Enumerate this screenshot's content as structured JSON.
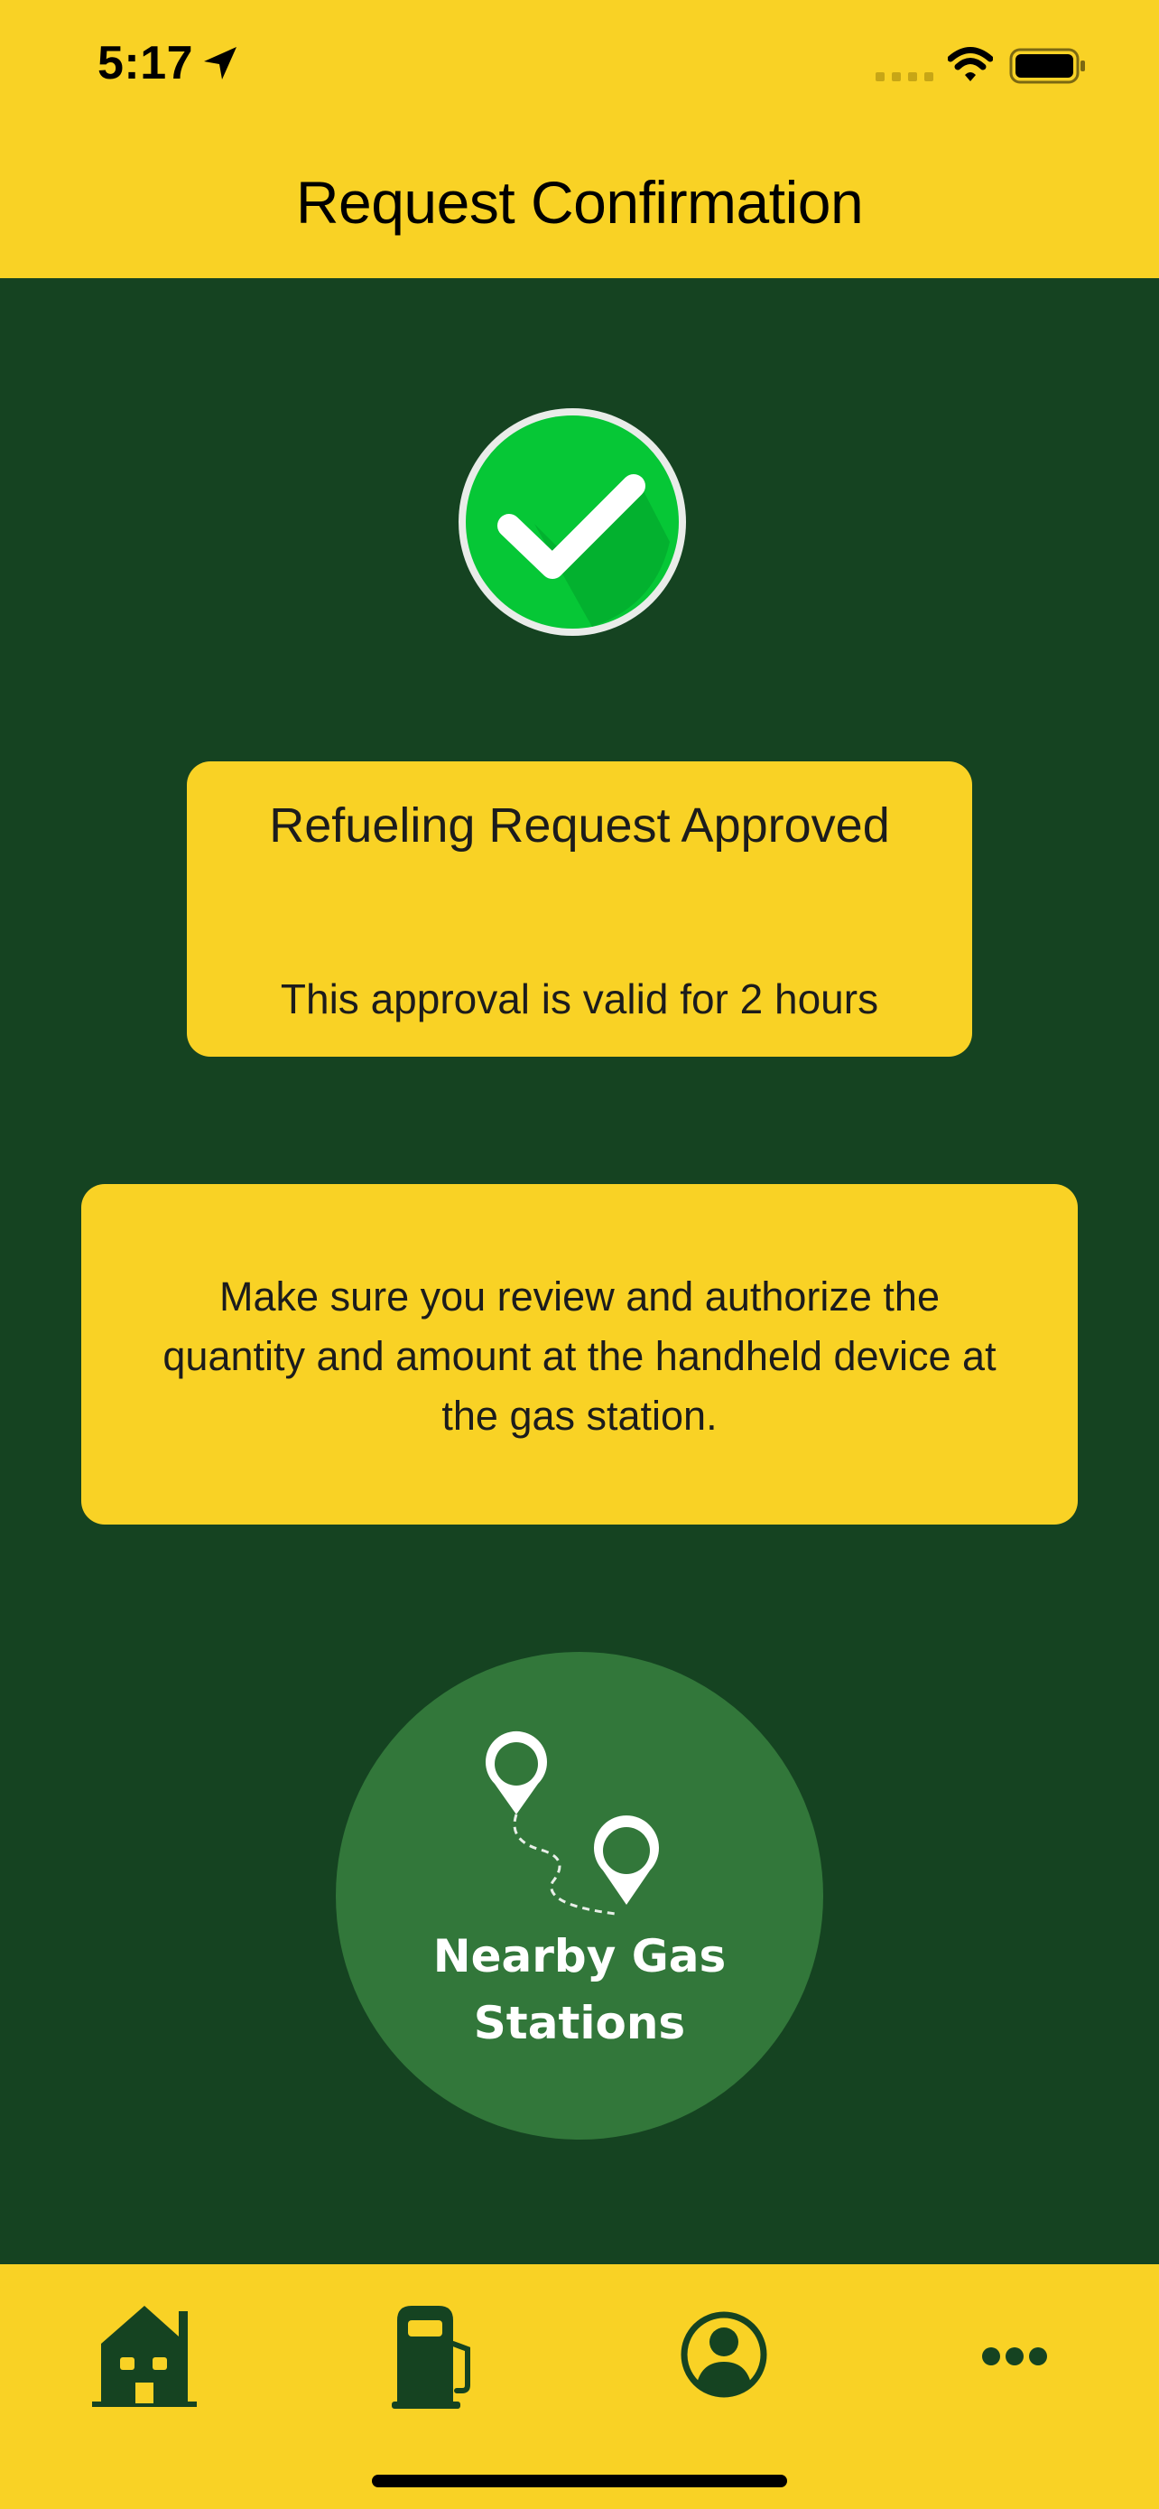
{
  "status_bar": {
    "time": "5:17",
    "icons": [
      "location-arrow-icon",
      "cellular-signal-icon",
      "wifi-icon",
      "battery-icon"
    ]
  },
  "header": {
    "title": "Request Confirmation"
  },
  "status_icon": "checkmark-circle-icon",
  "approval_card": {
    "title": "Refueling Request Approved",
    "subtitle": "This approval is valid for 2 hours"
  },
  "info_card": {
    "text": "Make sure you review and authorize the quantity and amount at the handheld device at the gas station."
  },
  "nearby_button": {
    "icon": "route-pins-icon",
    "line1": "Nearby Gas",
    "line2": "Stations"
  },
  "tab_bar": {
    "tabs": [
      {
        "icon": "home-icon",
        "active": true
      },
      {
        "icon": "fuel-pump-icon",
        "active": false
      },
      {
        "icon": "profile-icon",
        "active": false
      },
      {
        "icon": "more-icon",
        "active": false
      }
    ]
  },
  "colors": {
    "background": "#154321",
    "accent_yellow": "#f9d225",
    "button_green": "#32773a",
    "success_green": "#06c736",
    "icon_dark": "#154321"
  }
}
